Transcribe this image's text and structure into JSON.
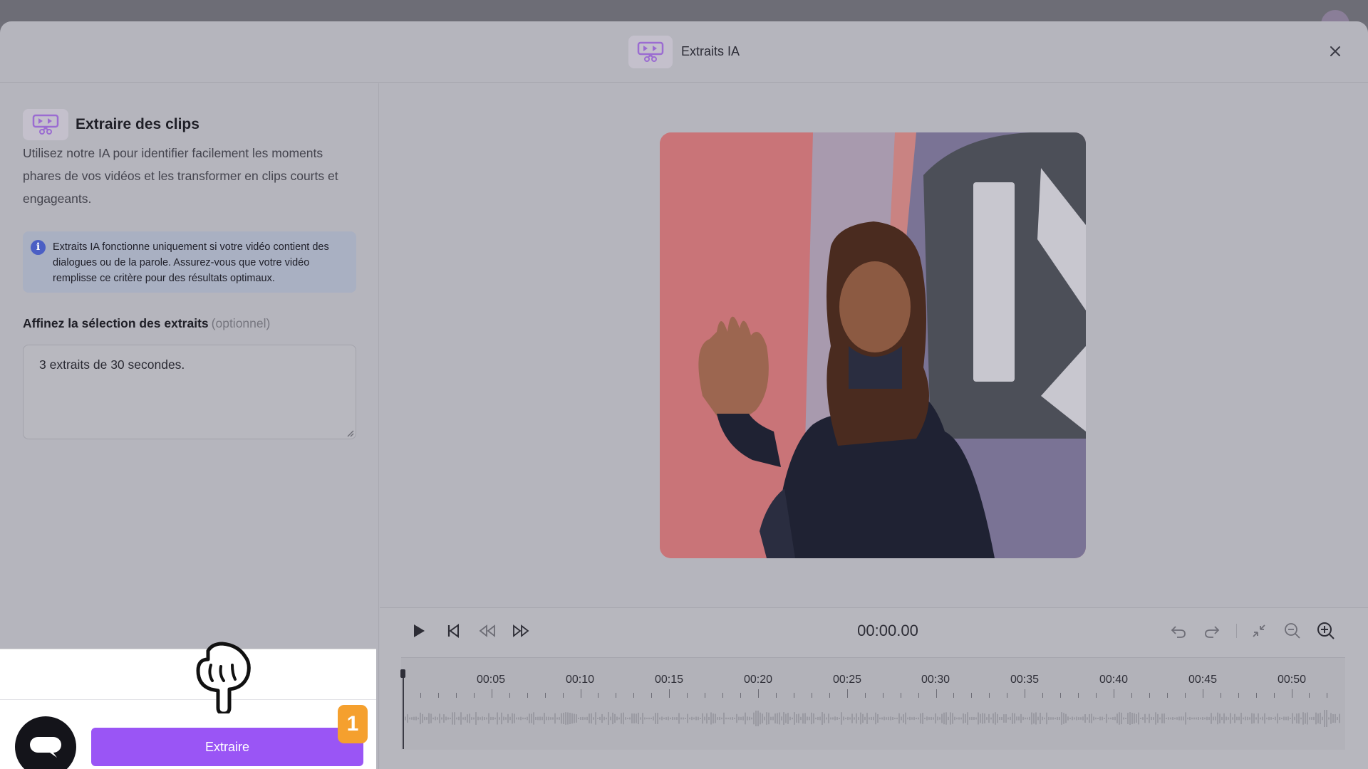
{
  "header": {
    "title": "Extraits IA",
    "close_icon": "close-icon"
  },
  "left_panel": {
    "title": "Extraire des clips",
    "description": "Utilisez notre IA pour identifier facilement les moments phares de vos vidéos et les transformer en clips courts et engageants.",
    "info_text": "Extraits IA fonctionne uniquement si votre vidéo contient des dialogues ou de la parole. Assurez-vous que votre vidéo remplisse ce critère pour des résultats optimaux.",
    "refine_label": "Affinez la sélection des extraits",
    "refine_optional": "(optionnel)",
    "refine_value": "3 extraits de 30 secondes."
  },
  "actions": {
    "extract_label": "Extraire",
    "step_number": "1"
  },
  "player": {
    "timecode": "00:00.00",
    "ticks": [
      "00:05",
      "00:10",
      "00:15",
      "00:20",
      "00:25",
      "00:30",
      "00:35",
      "00:40",
      "00:45",
      "00:50"
    ]
  },
  "colors": {
    "accent_purple": "#9a55f5",
    "badge_orange": "#f5a02e",
    "info_blue": "#4b5fc4",
    "overlay_gray": "#b5b5bd"
  }
}
